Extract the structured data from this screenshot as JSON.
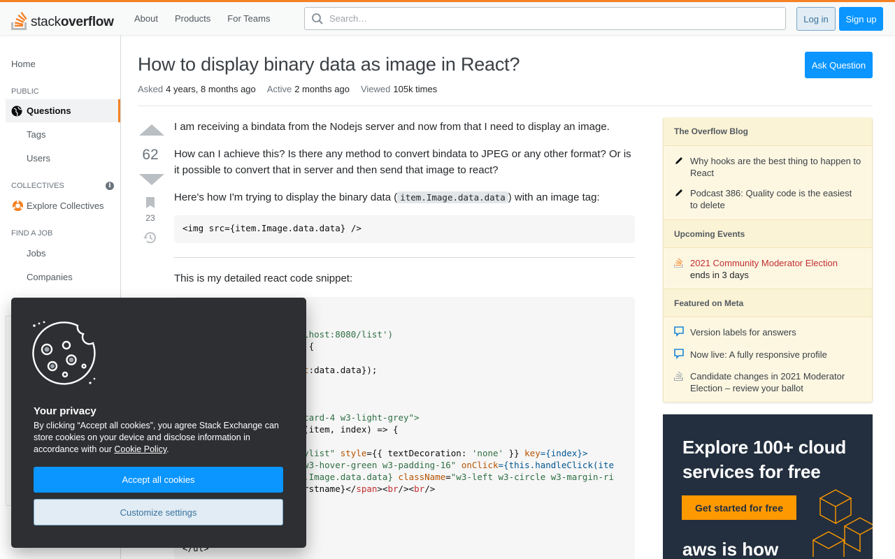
{
  "brand": {
    "logo_light": "stack",
    "logo_bold": "overflow",
    "accent": "#f48225",
    "primary": "#0a95ff"
  },
  "topnav": {
    "about": "About",
    "products": "Products",
    "for_teams": "For Teams"
  },
  "search": {
    "placeholder": "Search…"
  },
  "auth": {
    "login": "Log in",
    "signup": "Sign up"
  },
  "leftnav": {
    "home": "Home",
    "public_heading": "PUBLIC",
    "questions": "Questions",
    "tags": "Tags",
    "users": "Users",
    "collectives_heading": "COLLECTIVES",
    "explore_collectives": "Explore Collectives",
    "job_heading": "FIND A JOB",
    "jobs": "Jobs",
    "companies": "Companies"
  },
  "question": {
    "title": "How to display binary data as image in React?",
    "ask_button": "Ask Question",
    "asked_label": "Asked",
    "asked_value": "4 years, 8 months ago",
    "active_label": "Active",
    "active_value": "2 months ago",
    "viewed_label": "Viewed",
    "viewed_value": "105k times",
    "votes": "62",
    "bookmarks": "23",
    "p1": "I am receiving a bindata from the Nodejs server and now from that I need to display an image.",
    "p2": "How can I achieve this? Is there any method to convert bindata to JPEG or any other format? Or is it possible to convert that in server and then send that image to react?",
    "p3_before": "Here's how I'm trying to display the binary data (",
    "p3_code": "item.Image.data.data",
    "p3_after": ") with an image tag:",
    "code1": "<img src={item.Image.data.data} />",
    "p4": "This is my detailed react code snippet:"
  },
  "code2": {
    "l1a": "calhost:8080/list",
    "l1b": "')",
    "l2": "a) {",
    "l3": ");",
    "l4a": "ost",
    "l4b": ":data.data});",
    "l5a": "3-card-4 w3-light-grey",
    "l5b": "\">",
    "l6a": "p",
    "l6b": "((item, index) => {",
    "l7a": "laylist\"",
    "l7b": " style",
    "l7c": "={{ textDecoration: ",
    "l7d": "'none'",
    "l7e": " }} ",
    "l7f": "key",
    "l7g": "={index}>",
    "l8a": "\" w3-hover-green w3-padding-16\"",
    "l8b": " onClick",
    "l8c": "={this.handleClick(ite",
    "l9a": "em.Image.data.data} ",
    "l9b": "className",
    "l9c": "=",
    "l9d": "\"w3-left w3-circle w3-margin-ri",
    "l10a": "Firstname}</",
    "l10b": "span",
    "l10c": "><",
    "l10d": "br",
    "l10e": "/><",
    "l10f": "br",
    "l10g": "/>",
    "l11": "</ul>"
  },
  "sidebar": {
    "blog_heading": "The Overflow Blog",
    "blog_items": [
      "Why hooks are the best thing to happen to React",
      "Podcast 386: Quality code is the easiest to delete"
    ],
    "events_heading": "Upcoming Events",
    "event_title": "2021 Community Moderator Election",
    "event_sub": "ends in 3 days",
    "meta_heading": "Featured on Meta",
    "meta_items": [
      "Version labels for answers",
      "Now live: A fully responsive profile",
      "Candidate changes in 2021 Moderator Election – review your ballot"
    ]
  },
  "ad": {
    "headline": "Explore 100+ cloud services for free",
    "button": "Get started for free",
    "tail": "aws is how"
  },
  "cookie": {
    "title": "Your privacy",
    "text": "By clicking “Accept all cookies”, you agree Stack Exchange can store cookies on your device and disclose information in accordance with our ",
    "link": "Cookie Policy",
    "after_link": ".",
    "accept": "Accept all cookies",
    "customize": "Customize settings"
  }
}
